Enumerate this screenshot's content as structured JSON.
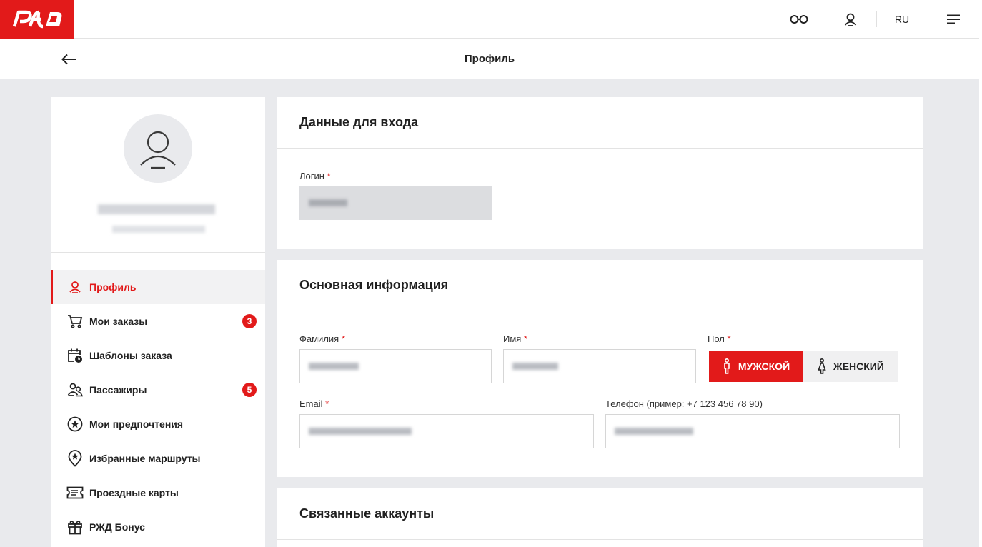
{
  "header": {
    "logo_text": "РЖД",
    "lang": "RU"
  },
  "subbar": {
    "title": "Профиль"
  },
  "sidebar": {
    "items": [
      {
        "label": "Профиль",
        "icon": "user-icon",
        "active": true
      },
      {
        "label": "Мои заказы",
        "icon": "cart-icon",
        "badge": "3"
      },
      {
        "label": "Шаблоны заказа",
        "icon": "calendar-clock-icon"
      },
      {
        "label": "Пассажиры",
        "icon": "passengers-icon",
        "badge": "5"
      },
      {
        "label": "Мои предпочтения",
        "icon": "star-circle-icon"
      },
      {
        "label": "Избранные маршруты",
        "icon": "star-pin-icon"
      },
      {
        "label": "Проездные карты",
        "icon": "ticket-icon"
      },
      {
        "label": "РЖД Бонус",
        "icon": "gift-icon"
      }
    ]
  },
  "login_card": {
    "title": "Данные для входа",
    "login_label": "Логин",
    "required_mark": "*"
  },
  "main_card": {
    "title": "Основная информация",
    "surname_label": "Фамилия",
    "name_label": "Имя",
    "gender_label": "Пол",
    "male_label": "МУЖСКОЙ",
    "female_label": "ЖЕНСКИЙ",
    "email_label": "Email",
    "phone_label": "Телефон (пример: +7 123 456 78 90)",
    "required_mark": "*"
  },
  "linked_card": {
    "title": "Связанные аккаунты"
  },
  "colors": {
    "brand": "#e21a1a",
    "background": "#e9eaed"
  }
}
